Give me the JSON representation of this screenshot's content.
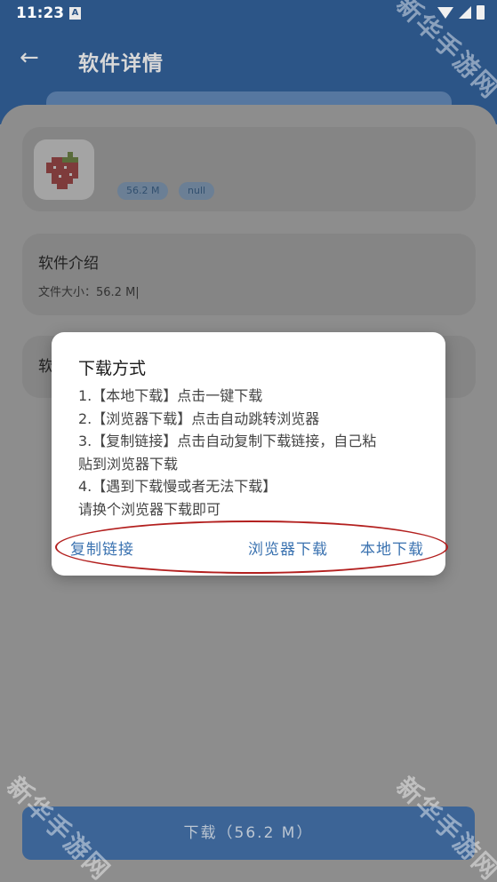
{
  "status_bar": {
    "time": "11:23",
    "notification_badge": "A"
  },
  "header": {
    "title": "软件详情",
    "back_icon": "arrow-left-icon"
  },
  "app_card": {
    "size_tag": "56.2 M",
    "null_tag": "null",
    "icon": "strawberry-icon"
  },
  "intro": {
    "title": "软件介绍",
    "file_size": "文件大小：56.2 M|"
  },
  "third_card": {
    "title_partial": "软"
  },
  "dialog": {
    "title": "下载方式",
    "lines": [
      "1.【本地下载】点击一键下载",
      "2.【浏览器下载】点击自动跳转浏览器",
      "3.【复制链接】点击自动复制下载链接，自己粘",
      "贴到浏览器下载",
      "4.【遇到下载慢或者无法下载】",
      "请换个浏览器下载即可"
    ],
    "actions": {
      "copy": "复制链接",
      "browser": "浏览器下载",
      "local": "本地下载"
    }
  },
  "download_button": {
    "label": "下载（56.2 M）"
  },
  "watermark": "新华手游网",
  "colors": {
    "header_blue": "#2c5587",
    "accent_blue": "#3a72b0",
    "annotation_red": "#b3201f"
  }
}
